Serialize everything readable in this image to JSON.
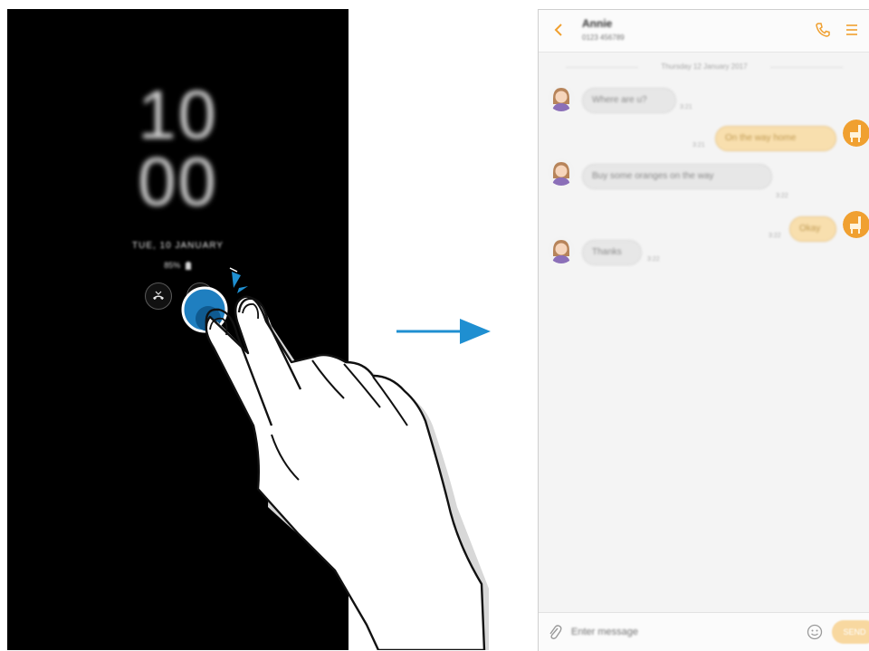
{
  "aod": {
    "hour": "10",
    "minute": "00",
    "date": "TUE, 10 JANUARY",
    "battery": "85%",
    "notifications": [
      "missed-call-icon",
      "message-icon"
    ]
  },
  "arrow": "right-arrow",
  "chat": {
    "contact_name": "Annie",
    "contact_number": "0123 456789",
    "date_separator": "Thursday 12 January 2017",
    "messages": [
      {
        "dir": "in",
        "text": "Where are u?",
        "time": "3:21"
      },
      {
        "dir": "out",
        "text": "On the way home",
        "time": "3:21"
      },
      {
        "dir": "in",
        "text": "Buy some oranges on the way",
        "time": "3:22"
      },
      {
        "dir": "out",
        "text": "Okay",
        "time": "3:22"
      },
      {
        "dir": "in",
        "text": "Thanks",
        "time": "3:22"
      }
    ],
    "compose_placeholder": "Enter message",
    "send_label": "SEND"
  },
  "colors": {
    "accent": "#f0a030",
    "arrow": "#1f8fd1",
    "incoming_bubble": "#e7e7e7",
    "outgoing_bubble": "#f8dfae"
  }
}
